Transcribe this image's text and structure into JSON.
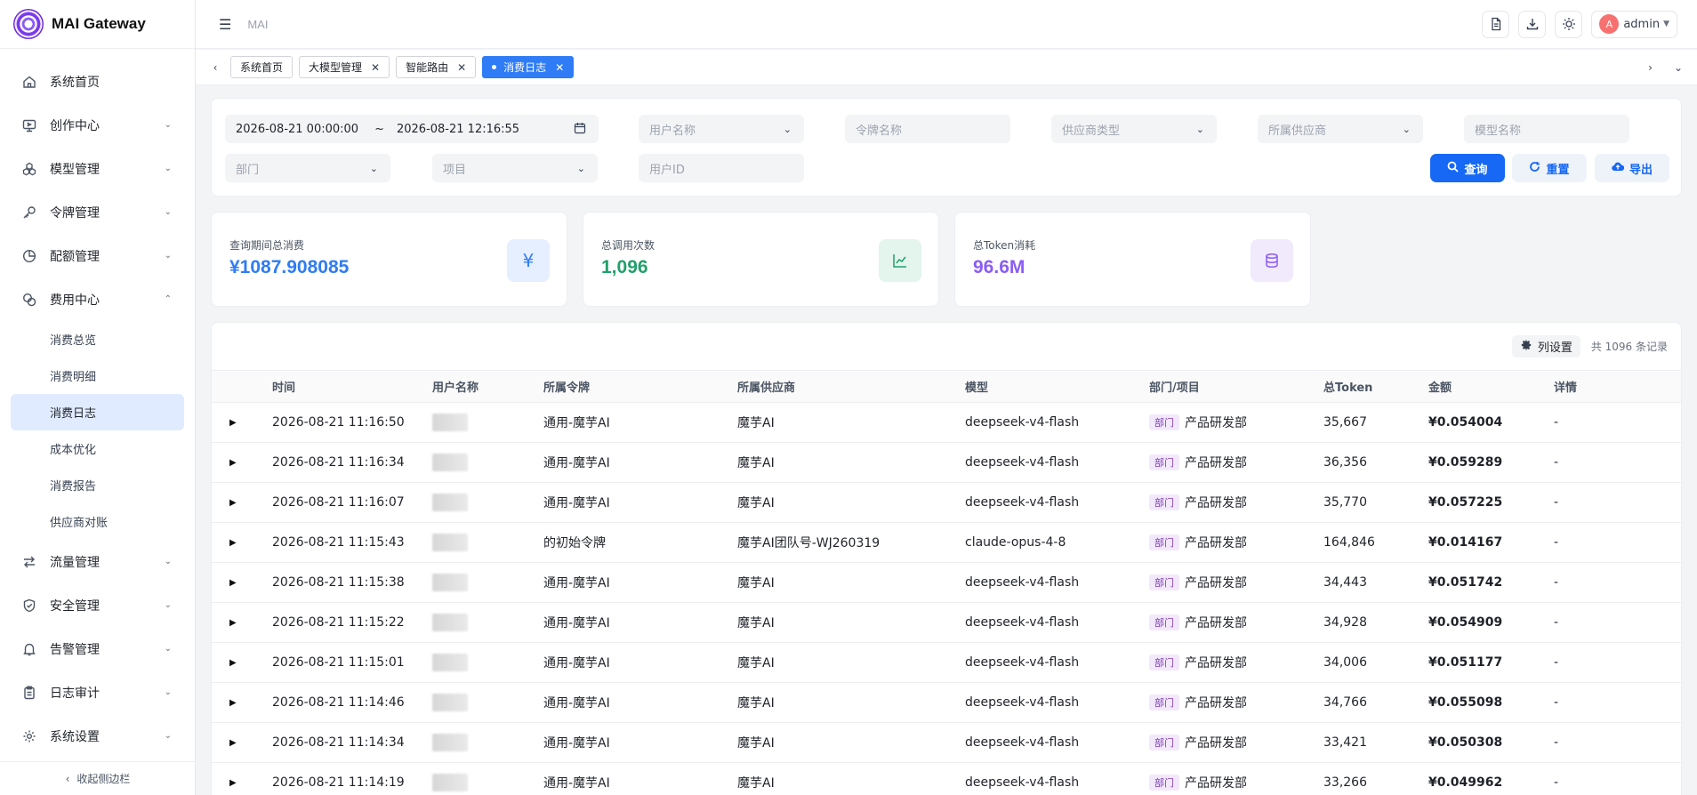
{
  "app": {
    "name": "MAI Gateway",
    "breadcrumb": "MAI"
  },
  "header": {
    "user": "admin",
    "avatar_letter": "A"
  },
  "sidebar": {
    "items": [
      {
        "label": "系统首页",
        "icon": "home-icon",
        "chevron": ""
      },
      {
        "label": "创作中心",
        "icon": "monitor-icon",
        "chevron": "⌄"
      },
      {
        "label": "模型管理",
        "icon": "cubes-icon",
        "chevron": "⌄"
      },
      {
        "label": "令牌管理",
        "icon": "key-icon",
        "chevron": "⌄"
      },
      {
        "label": "配额管理",
        "icon": "pie-icon",
        "chevron": "⌄"
      },
      {
        "label": "费用中心",
        "icon": "coins-icon",
        "chevron": "⌃"
      }
    ],
    "sub_items": [
      {
        "label": "消费总览"
      },
      {
        "label": "消费明细"
      },
      {
        "label": "消费日志"
      },
      {
        "label": "成本优化"
      },
      {
        "label": "消费报告"
      },
      {
        "label": "供应商对账"
      }
    ],
    "items_after": [
      {
        "label": "流量管理",
        "icon": "swap-icon",
        "chevron": "⌄"
      },
      {
        "label": "安全管理",
        "icon": "shield-icon",
        "chevron": "⌄"
      },
      {
        "label": "告警管理",
        "icon": "bell-icon",
        "chevron": "⌄"
      },
      {
        "label": "日志审计",
        "icon": "clipboard-icon",
        "chevron": "⌄"
      },
      {
        "label": "系统设置",
        "icon": "gear-icon",
        "chevron": "⌄"
      }
    ],
    "collapse_label": "收起侧边栏"
  },
  "tabs": [
    {
      "label": "系统首页"
    },
    {
      "label": "大模型管理"
    },
    {
      "label": "智能路由"
    },
    {
      "label": "消费日志"
    }
  ],
  "filters": {
    "date_start": "2026-08-21 00:00:00",
    "date_sep": "~",
    "date_end": "2026-08-21 12:16:55",
    "user_name": "用户名称",
    "token_name": "令牌名称",
    "provider_type": "供应商类型",
    "provider": "所属供应商",
    "model_name": "模型名称",
    "department": "部门",
    "project": "项目",
    "user_id": "用户ID",
    "query_btn": "查询",
    "reset_btn": "重置",
    "export_btn": "导出"
  },
  "stats": {
    "total_cost_label": "查询期间总消费",
    "total_cost": "¥1087.908085",
    "calls_label": "总调用次数",
    "calls": "1,096",
    "tokens_label": "总Token消耗",
    "tokens": "96.6M",
    "yen_symbol": "¥"
  },
  "table": {
    "column_settings": "列设置",
    "total_records": "共 1096 条记录",
    "columns": [
      "时间",
      "用户名称",
      "所属令牌",
      "所属供应商",
      "模型",
      "部门/项目",
      "总Token",
      "金额",
      "详情"
    ],
    "dept_tag": "部门",
    "rows": [
      {
        "time": "2026-08-21 11:16:50",
        "token": "通用-魔芋AI",
        "provider": "魔芋AI",
        "model": "deepseek-v4-flash",
        "dept": "产品研发部",
        "tokens": "35,667",
        "amount": "¥0.054004",
        "detail": "-"
      },
      {
        "time": "2026-08-21 11:16:34",
        "token": "通用-魔芋AI",
        "provider": "魔芋AI",
        "model": "deepseek-v4-flash",
        "dept": "产品研发部",
        "tokens": "36,356",
        "amount": "¥0.059289",
        "detail": "-"
      },
      {
        "time": "2026-08-21 11:16:07",
        "token": "通用-魔芋AI",
        "provider": "魔芋AI",
        "model": "deepseek-v4-flash",
        "dept": "产品研发部",
        "tokens": "35,770",
        "amount": "¥0.057225",
        "detail": "-"
      },
      {
        "time": "2026-08-21 11:15:43",
        "token": "的初始令牌",
        "provider": "魔芋AI团队号-WJ260319",
        "model": "claude-opus-4-8",
        "dept": "产品研发部",
        "tokens": "164,846",
        "amount": "¥0.014167",
        "detail": "-"
      },
      {
        "time": "2026-08-21 11:15:38",
        "token": "通用-魔芋AI",
        "provider": "魔芋AI",
        "model": "deepseek-v4-flash",
        "dept": "产品研发部",
        "tokens": "34,443",
        "amount": "¥0.051742",
        "detail": "-"
      },
      {
        "time": "2026-08-21 11:15:22",
        "token": "通用-魔芋AI",
        "provider": "魔芋AI",
        "model": "deepseek-v4-flash",
        "dept": "产品研发部",
        "tokens": "34,928",
        "amount": "¥0.054909",
        "detail": "-"
      },
      {
        "time": "2026-08-21 11:15:01",
        "token": "通用-魔芋AI",
        "provider": "魔芋AI",
        "model": "deepseek-v4-flash",
        "dept": "产品研发部",
        "tokens": "34,006",
        "amount": "¥0.051177",
        "detail": "-"
      },
      {
        "time": "2026-08-21 11:14:46",
        "token": "通用-魔芋AI",
        "provider": "魔芋AI",
        "model": "deepseek-v4-flash",
        "dept": "产品研发部",
        "tokens": "34,766",
        "amount": "¥0.055098",
        "detail": "-"
      },
      {
        "time": "2026-08-21 11:14:34",
        "token": "通用-魔芋AI",
        "provider": "魔芋AI",
        "model": "deepseek-v4-flash",
        "dept": "产品研发部",
        "tokens": "33,421",
        "amount": "¥0.050308",
        "detail": "-"
      },
      {
        "time": "2026-08-21 11:14:19",
        "token": "通用-魔芋AI",
        "provider": "魔芋AI",
        "model": "deepseek-v4-flash",
        "dept": "产品研发部",
        "tokens": "33,266",
        "amount": "¥0.049962",
        "detail": "-"
      }
    ]
  },
  "colors": {
    "primary": "#1668f5",
    "cost": "#2f7cf6",
    "calls": "#22a06b",
    "tokens": "#8b5cf6",
    "active_nav_bg": "#e0ebff",
    "dept_tag_bg": "#f3e8fb"
  }
}
